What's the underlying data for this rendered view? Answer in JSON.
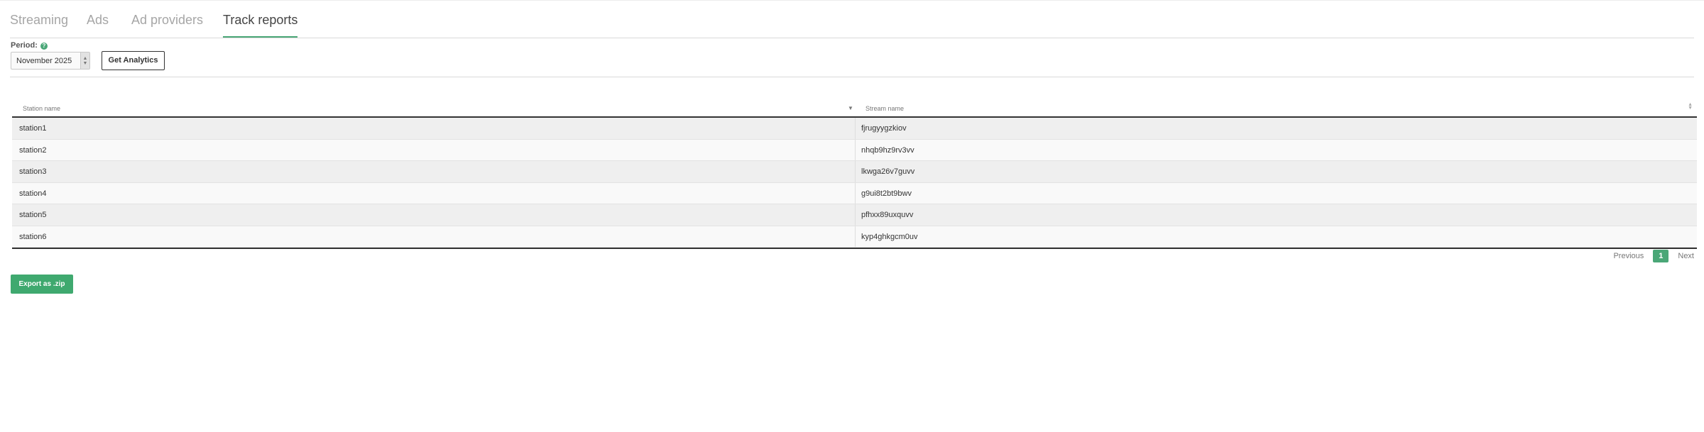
{
  "tabs": [
    {
      "label": "Streaming",
      "active": false
    },
    {
      "label": "Ads",
      "active": false
    },
    {
      "label": "Ad providers",
      "active": false
    },
    {
      "label": "Track reports",
      "active": true
    }
  ],
  "filters": {
    "period_label": "Period:",
    "help_icon": "?",
    "period_value": "November 2025",
    "get_analytics_label": "Get Analytics"
  },
  "table": {
    "columns": [
      "Station name",
      "Stream name"
    ],
    "rows": [
      {
        "station": "station1",
        "stream": "fjrugyygzkiov"
      },
      {
        "station": "station2",
        "stream": "nhqb9hz9rv3vv"
      },
      {
        "station": "station3",
        "stream": "lkwga26v7guvv"
      },
      {
        "station": "station4",
        "stream": "g9ui8t2bt9bwv"
      },
      {
        "station": "station5",
        "stream": "pfhxx89uxquvv"
      },
      {
        "station": "station6",
        "stream": "kyp4ghkgcm0uv"
      }
    ]
  },
  "pagination": {
    "previous_label": "Previous",
    "current_page": "1",
    "next_label": "Next"
  },
  "export_label": "Export as .zip",
  "colors": {
    "accent": "#4aa777",
    "export_button": "#3fa96f"
  }
}
